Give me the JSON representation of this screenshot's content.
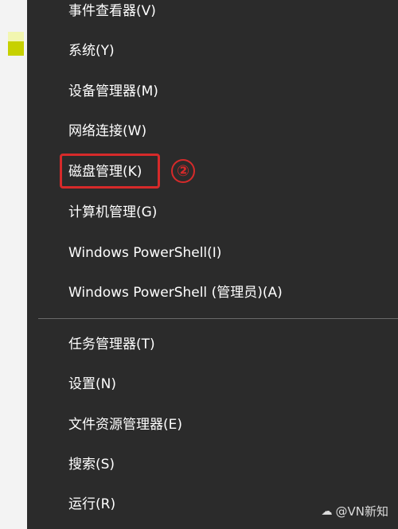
{
  "menu": {
    "items": [
      {
        "label": "事件查看器(V)"
      },
      {
        "label": "系统(Y)"
      },
      {
        "label": "设备管理器(M)"
      },
      {
        "label": "网络连接(W)"
      },
      {
        "label": "磁盘管理(K)"
      },
      {
        "label": "计算机管理(G)"
      },
      {
        "label": "Windows PowerShell(I)"
      },
      {
        "label": "Windows PowerShell (管理员)(A)"
      },
      {
        "label": "任务管理器(T)"
      },
      {
        "label": "设置(N)"
      },
      {
        "label": "文件资源管理器(E)"
      },
      {
        "label": "搜索(S)"
      },
      {
        "label": "运行(R)"
      }
    ]
  },
  "annotation": {
    "step_label": "②",
    "highlight_color": "#d62a2a"
  },
  "watermark": {
    "icon": "weibo-icon",
    "text": "@VN新知"
  },
  "colors": {
    "menu_background": "#2b2b2b",
    "menu_text": "#ffffff",
    "separator": "#6a6a6a"
  }
}
